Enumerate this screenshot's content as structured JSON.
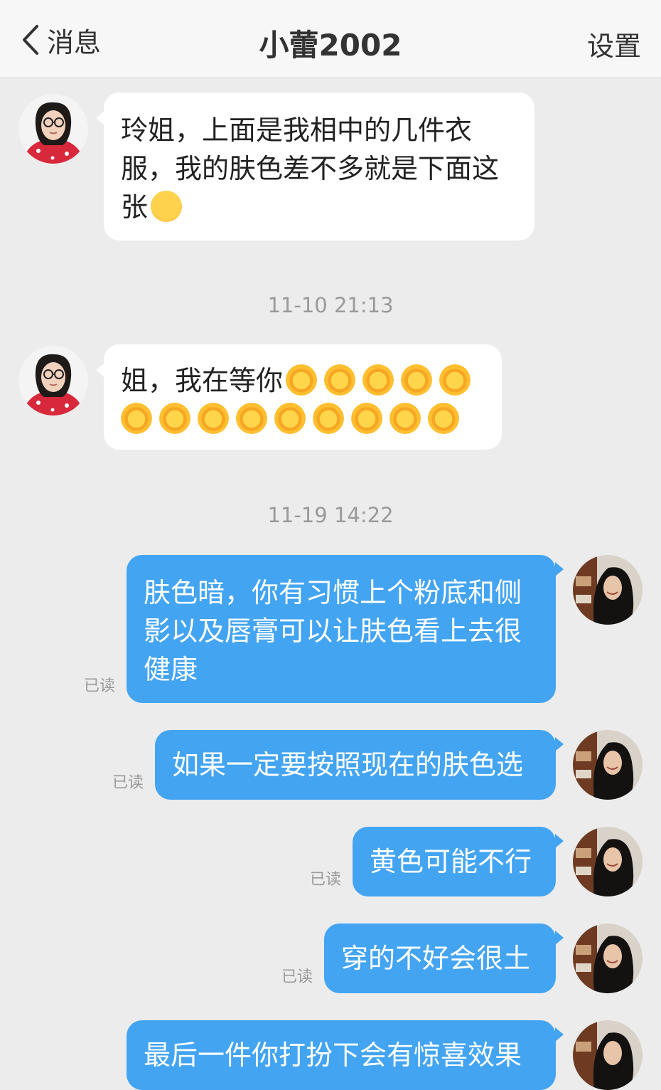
{
  "nav": {
    "back_label": "消息",
    "title": "小蕾2002",
    "settings_label": "设置"
  },
  "messages": [
    {
      "direction": "incoming",
      "text": "玲姐，上面是我相中的几件衣服，我的肤色差不多就是下面这张",
      "line1": "玲姐，上面是我相中的几件衣",
      "line2": "服，我的肤色差不多就是下面这",
      "line3": "张",
      "emoji": "blushing-smile-emoji"
    },
    {
      "timestamp": "11-10 21:13"
    },
    {
      "direction": "incoming",
      "text": "姐，我在等你",
      "emoji": "sun-smile-emoji",
      "emoji_count": 14
    },
    {
      "timestamp": "11-19 14:22"
    },
    {
      "direction": "outgoing",
      "line1": "肤色暗，你有习惯上个粉底和侧",
      "line2": "影以及唇膏可以让肤色看上去很",
      "line3": "健康",
      "status": "已读"
    },
    {
      "direction": "outgoing",
      "text": "如果一定要按照现在的肤色选",
      "status": "已读"
    },
    {
      "direction": "outgoing",
      "text": "黄色可能不行",
      "status": "已读"
    },
    {
      "direction": "outgoing",
      "text": "穿的不好会很土",
      "status": "已读"
    },
    {
      "direction": "outgoing",
      "text": "最后一件你打扮下会有惊喜效果",
      "status": ""
    }
  ]
}
